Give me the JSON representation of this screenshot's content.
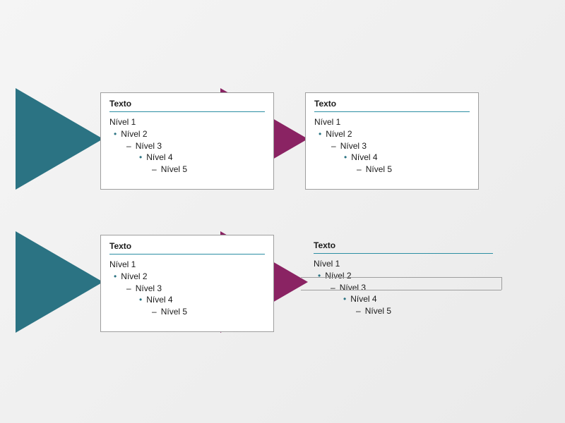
{
  "colors": {
    "teal_triangle": "#2b7383",
    "purple_triangle": "#8a2363",
    "card_bg": "#ffffff",
    "card_border": "#9e9e9e",
    "title_rule": "#2b8ea3",
    "text": "#1a1a1a"
  },
  "cards": {
    "tl": {
      "title": "Texto",
      "levels": [
        "Nível 1",
        "Nível 2",
        "Nível 3",
        "Nível 4",
        "Nível 5"
      ]
    },
    "tr": {
      "title": "Texto",
      "levels": [
        "Nível 1",
        "Nível 2",
        "Nível 3",
        "Nível 4",
        "Nível 5"
      ]
    },
    "bl": {
      "title": "Texto",
      "levels": [
        "Nível 1",
        "Nível 2",
        "Nível 3",
        "Nível 4",
        "Nível 5"
      ]
    },
    "br": {
      "title": "Texto",
      "levels": [
        "Nível 1",
        "Nível 2",
        "Nível 3",
        "Nível 4",
        "Nível 5"
      ]
    }
  },
  "bullets": {
    "dot": "•",
    "dash": "–"
  }
}
